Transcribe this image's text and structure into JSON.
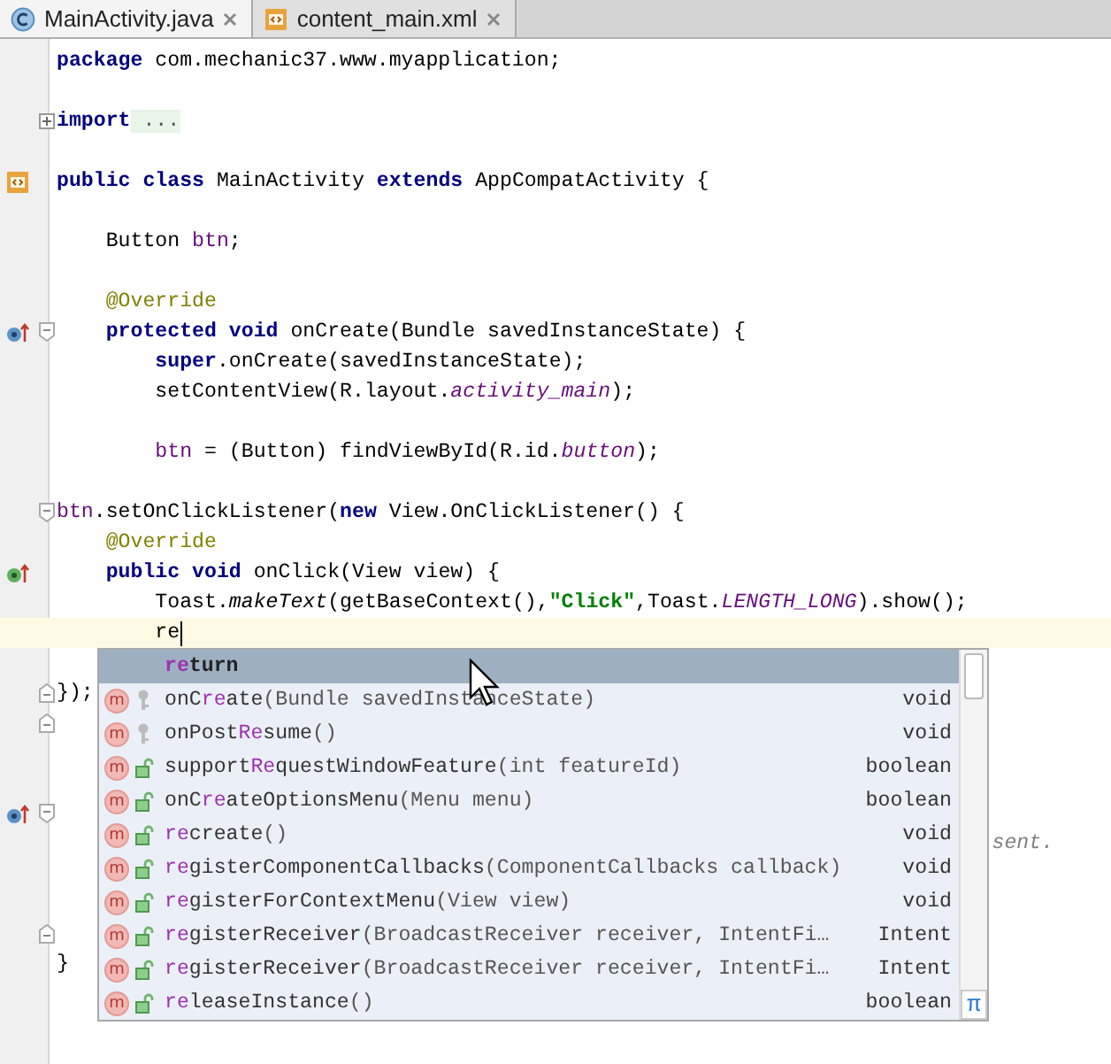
{
  "tabs": [
    {
      "label": "MainActivity.java",
      "kind": "java",
      "selected": true
    },
    {
      "label": "content_main.xml",
      "kind": "xml",
      "selected": false
    }
  ],
  "editor": {
    "lines": [
      {
        "current": false,
        "segments": [
          {
            "kind": "kw",
            "text": "package"
          },
          {
            "kind": "plain",
            "text": " com.mechanic37.www.myapplication;"
          }
        ]
      },
      {
        "current": false
      },
      {
        "current": false,
        "fold": {
          "kind": "collapsed"
        },
        "segments": [
          {
            "kind": "kw",
            "text": "import"
          },
          {
            "kind": "folded",
            "text": " ..."
          }
        ]
      },
      {
        "current": false
      },
      {
        "current": false,
        "marker": {
          "kind": "xml"
        },
        "segments": [
          {
            "kind": "kw",
            "text": "public class"
          },
          {
            "kind": "plain",
            "text": " MainActivity "
          },
          {
            "kind": "kw",
            "text": "extends"
          },
          {
            "kind": "plain",
            "text": " AppCompatActivity {"
          }
        ]
      },
      {
        "current": false
      },
      {
        "current": false,
        "segments": [
          {
            "kind": "plain",
            "text": "    Button "
          },
          {
            "kind": "field",
            "text": "btn"
          },
          {
            "kind": "plain",
            "text": ";"
          }
        ]
      },
      {
        "current": false
      },
      {
        "current": false,
        "segments": [
          {
            "kind": "annotation",
            "text": "    @Override"
          }
        ]
      },
      {
        "current": false,
        "marker": {
          "kind": "override"
        },
        "fold": {
          "kind": "start"
        },
        "segments": [
          {
            "kind": "kw",
            "text": "    protected void"
          },
          {
            "kind": "plain",
            "text": " onCreate(Bundle savedInstanceState) {"
          }
        ]
      },
      {
        "current": false,
        "segments": [
          {
            "kind": "kw",
            "text": "        super"
          },
          {
            "kind": "plain",
            "text": ".onCreate(savedInstanceState);"
          }
        ]
      },
      {
        "current": false,
        "segments": [
          {
            "kind": "plain",
            "text": "        setContentView(R.layout."
          },
          {
            "kind": "static",
            "text": "activity_main"
          },
          {
            "kind": "plain",
            "text": ");"
          }
        ]
      },
      {
        "current": false
      },
      {
        "current": false,
        "segments": [
          {
            "kind": "field",
            "text": "        btn"
          },
          {
            "kind": "plain",
            "text": " = (Button) findViewById(R.id."
          },
          {
            "kind": "static",
            "text": "button"
          },
          {
            "kind": "plain",
            "text": ");"
          }
        ]
      },
      {
        "current": false
      },
      {
        "current": false,
        "fold": {
          "kind": "start"
        },
        "segments": [
          {
            "kind": "field",
            "text": "btn"
          },
          {
            "kind": "plain",
            "text": ".setOnClickListener("
          },
          {
            "kind": "kw",
            "text": "new"
          },
          {
            "kind": "plain",
            "text": " View.OnClickListener() {"
          }
        ]
      },
      {
        "current": false,
        "segments": [
          {
            "kind": "annotation",
            "text": "    @Override"
          }
        ]
      },
      {
        "current": false,
        "marker": {
          "kind": "implement"
        },
        "segments": [
          {
            "kind": "kw",
            "text": "    public void"
          },
          {
            "kind": "plain",
            "text": " onClick(View view) {"
          }
        ]
      },
      {
        "current": false,
        "segments": [
          {
            "kind": "plain",
            "text": "        Toast."
          },
          {
            "kind": "italic",
            "text": "makeText"
          },
          {
            "kind": "plain",
            "text": "(getBaseContext(),"
          },
          {
            "kind": "string",
            "text": "\"Click\""
          },
          {
            "kind": "plain",
            "text": ",Toast."
          },
          {
            "kind": "static",
            "text": "LENGTH_LONG"
          },
          {
            "kind": "plain",
            "text": ").show();"
          }
        ]
      },
      {
        "current": true,
        "segments": [
          {
            "kind": "plain",
            "text": "        re"
          }
        ]
      },
      {
        "current": false
      },
      {
        "current": false,
        "fold": {
          "kind": "end"
        },
        "segments": [
          {
            "kind": "plain",
            "text": "});"
          }
        ]
      },
      {
        "current": false,
        "fold": {
          "kind": "end"
        }
      },
      {
        "current": false
      },
      {
        "current": false
      },
      {
        "current": false,
        "marker": {
          "kind": "override"
        },
        "fold": {
          "kind": "start"
        }
      },
      {
        "current": false,
        "segments": [
          {
            "kind": "comment",
            "text": "                                                                            sent."
          }
        ]
      },
      {
        "current": false
      },
      {
        "current": false
      },
      {
        "current": false,
        "fold": {
          "kind": "end"
        }
      },
      {
        "current": false,
        "segments": [
          {
            "kind": "plain",
            "text": "}"
          }
        ]
      }
    ]
  },
  "completion": {
    "pi_button": "π",
    "items": [
      {
        "kind": "keyword",
        "selected": true,
        "name": [
          {
            "text": "re",
            "match": true
          },
          {
            "text": "turn",
            "match": false
          }
        ]
      },
      {
        "kind": "method",
        "selected": false,
        "badge": "m",
        "access": {
          "kind": "protected"
        },
        "name": [
          {
            "text": "onC",
            "match": false
          },
          {
            "text": "re",
            "match": true
          },
          {
            "text": "ate",
            "match": false
          }
        ],
        "params": "(Bundle savedInstanceState)",
        "type": "void"
      },
      {
        "kind": "method",
        "selected": false,
        "badge": "m",
        "access": {
          "kind": "protected"
        },
        "name": [
          {
            "text": "onPost",
            "match": false
          },
          {
            "text": "Re",
            "match": true
          },
          {
            "text": "sume",
            "match": false
          }
        ],
        "params": "()",
        "type": "void"
      },
      {
        "kind": "method",
        "selected": false,
        "badge": "m",
        "access": {
          "kind": "public"
        },
        "name": [
          {
            "text": "support",
            "match": false
          },
          {
            "text": "Re",
            "match": true
          },
          {
            "text": "questWindowFeature",
            "match": false
          }
        ],
        "params": "(int featureId)",
        "type": "boolean"
      },
      {
        "kind": "method",
        "selected": false,
        "badge": "m",
        "access": {
          "kind": "public"
        },
        "name": [
          {
            "text": "onC",
            "match": false
          },
          {
            "text": "re",
            "match": true
          },
          {
            "text": "ateOptionsMenu",
            "match": false
          }
        ],
        "params": "(Menu menu)",
        "type": "boolean"
      },
      {
        "kind": "method",
        "selected": false,
        "badge": "m",
        "access": {
          "kind": "public"
        },
        "name": [
          {
            "text": "re",
            "match": true
          },
          {
            "text": "create",
            "match": false
          }
        ],
        "params": "()",
        "type": "void"
      },
      {
        "kind": "method",
        "selected": false,
        "badge": "m",
        "access": {
          "kind": "public"
        },
        "name": [
          {
            "text": "re",
            "match": true
          },
          {
            "text": "gisterComponentCallbacks",
            "match": false
          }
        ],
        "params": "(ComponentCallbacks callback)",
        "type": "void"
      },
      {
        "kind": "method",
        "selected": false,
        "badge": "m",
        "access": {
          "kind": "public"
        },
        "name": [
          {
            "text": "re",
            "match": true
          },
          {
            "text": "gisterForContextMenu",
            "match": false
          }
        ],
        "params": "(View view)",
        "type": "void"
      },
      {
        "kind": "method",
        "selected": false,
        "badge": "m",
        "access": {
          "kind": "public"
        },
        "name": [
          {
            "text": "re",
            "match": true
          },
          {
            "text": "gisterReceiver",
            "match": false
          }
        ],
        "params": "(BroadcastReceiver receiver, IntentFi…",
        "type": "Intent"
      },
      {
        "kind": "method",
        "selected": false,
        "badge": "m",
        "access": {
          "kind": "public"
        },
        "name": [
          {
            "text": "re",
            "match": true
          },
          {
            "text": "gisterReceiver",
            "match": false
          }
        ],
        "params": "(BroadcastReceiver receiver, IntentFi…",
        "type": "Intent"
      },
      {
        "kind": "method",
        "selected": false,
        "badge": "m",
        "access": {
          "kind": "public"
        },
        "name": [
          {
            "text": "re",
            "match": true
          },
          {
            "text": "leaseInstance",
            "match": false
          }
        ],
        "params": "()",
        "type": "boolean"
      }
    ]
  }
}
